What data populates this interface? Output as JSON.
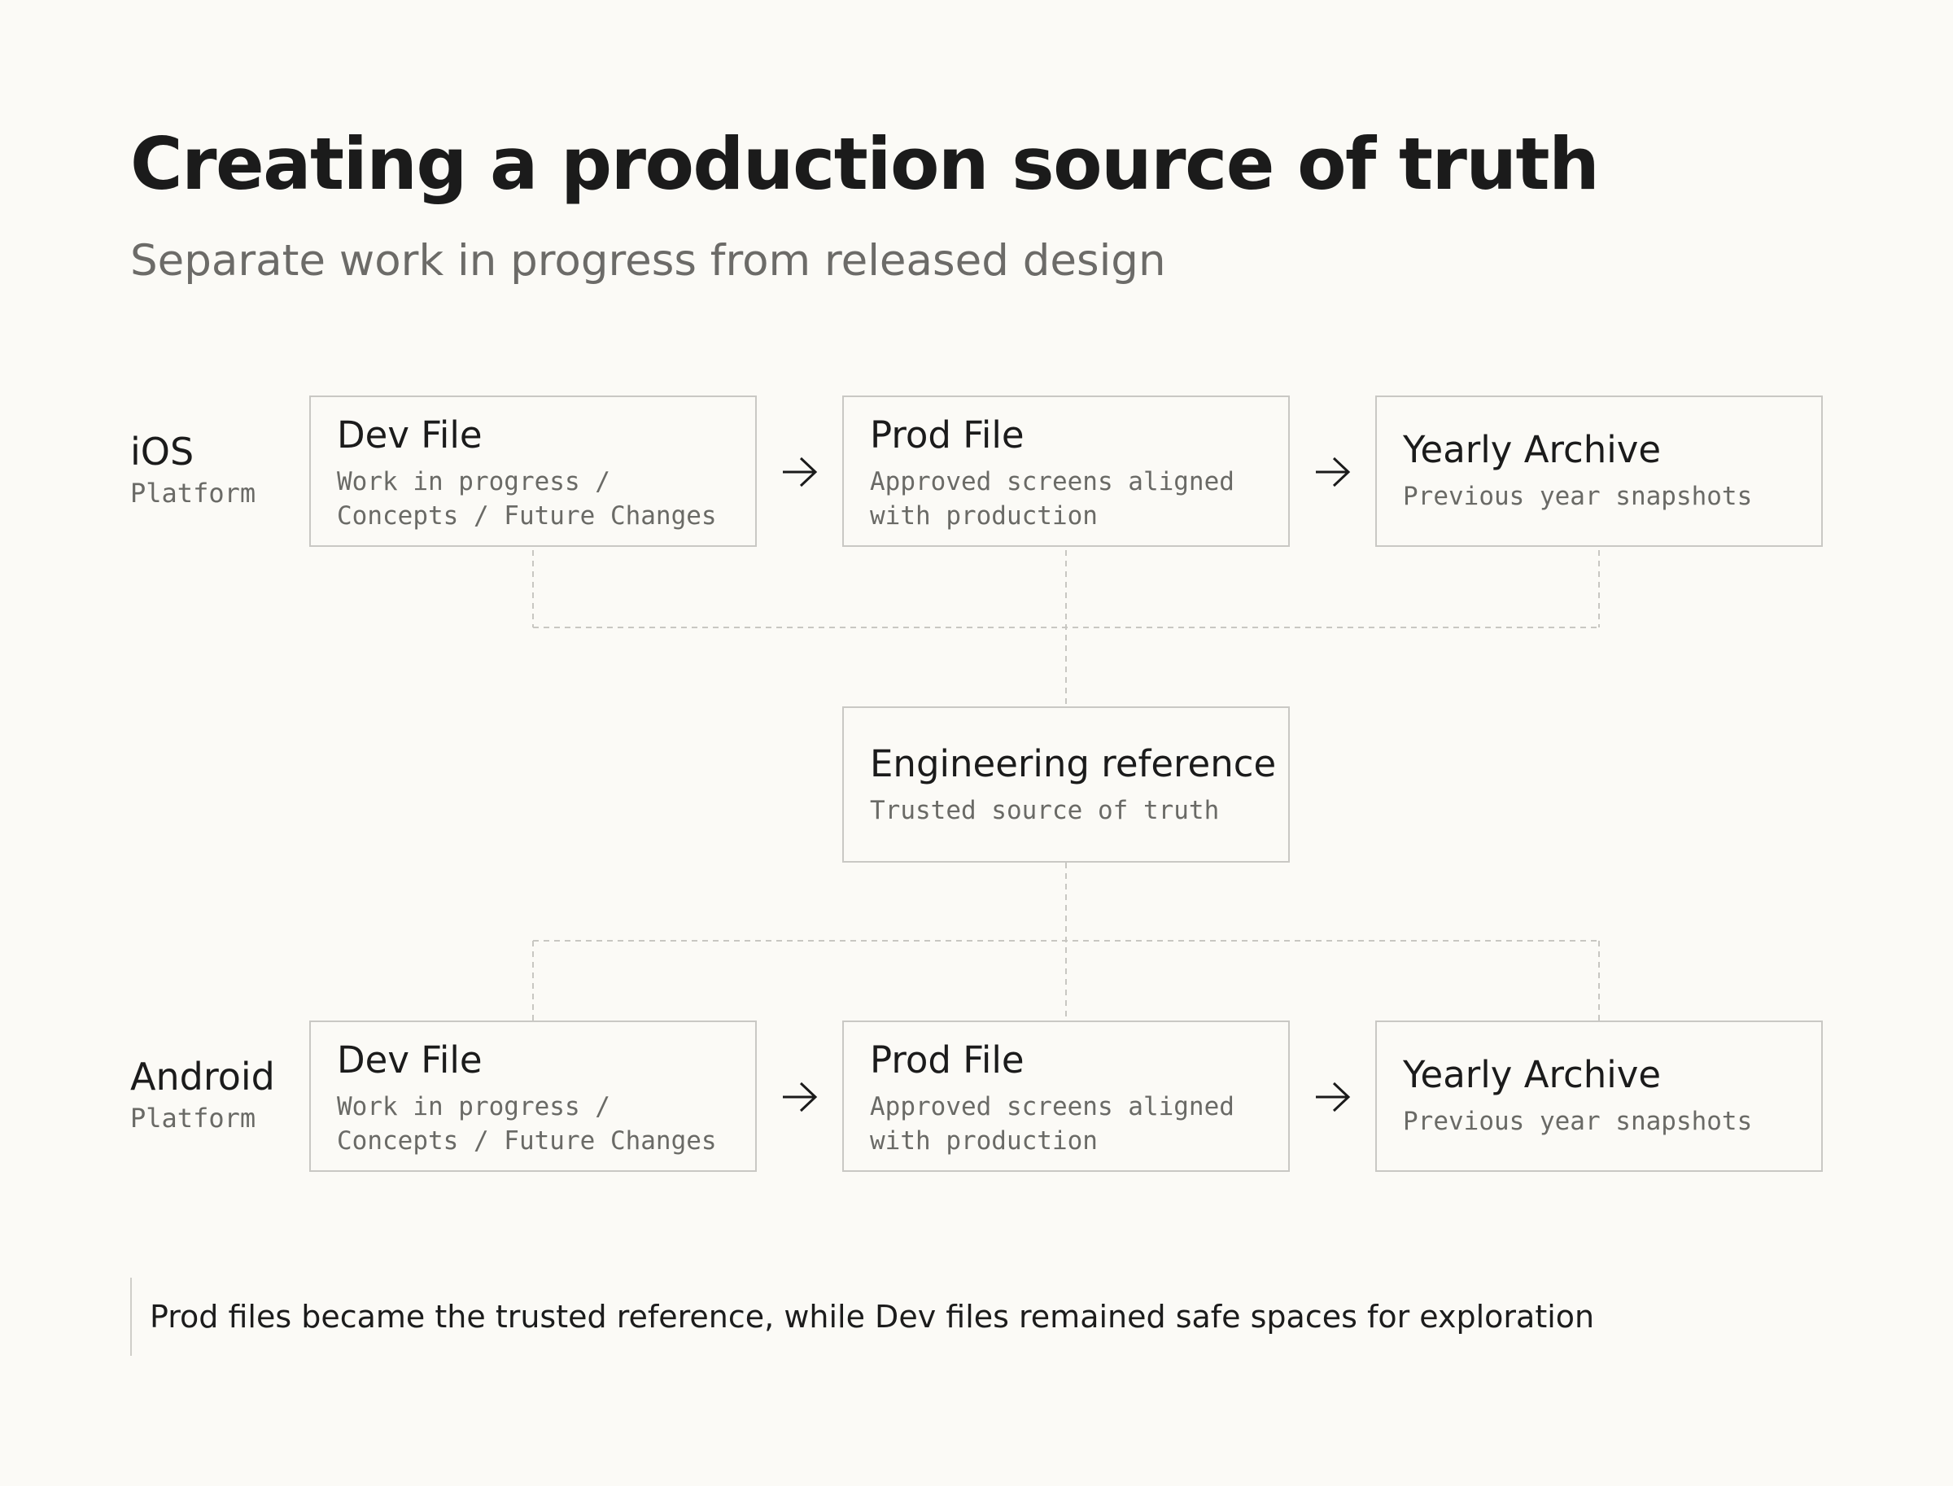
{
  "header": {
    "title": "Creating a production source of truth",
    "subtitle": "Separate work in progress from released design"
  },
  "rows": [
    {
      "platform": "iOS",
      "platform_sub": "Platform",
      "boxes": [
        {
          "title": "Dev File",
          "desc": "Work in progress /\nConcepts / Future Changes"
        },
        {
          "title": "Prod File",
          "desc": "Approved screens aligned\nwith production"
        },
        {
          "title": "Yearly Archive",
          "desc": "Previous year snapshots"
        }
      ]
    },
    {
      "platform": "Android",
      "platform_sub": "Platform",
      "boxes": [
        {
          "title": "Dev File",
          "desc": "Work in progress /\nConcepts / Future Changes"
        },
        {
          "title": "Prod File",
          "desc": "Approved screens aligned\nwith production"
        },
        {
          "title": "Yearly Archive",
          "desc": "Previous year snapshots"
        }
      ]
    }
  ],
  "engineering": {
    "title": "Engineering reference",
    "desc": "Trusted source of truth"
  },
  "note": "Prod files became the trusted reference, while Dev files remained safe spaces for exploration",
  "colors": {
    "background": "#fbfaf6",
    "box_border": "#c9c8c4",
    "connector": "#c8c7c2",
    "text_primary": "#1b1b1b",
    "text_secondary": "#6a6a66"
  },
  "icons": {
    "flow_arrow": "arrow-right-icon"
  }
}
